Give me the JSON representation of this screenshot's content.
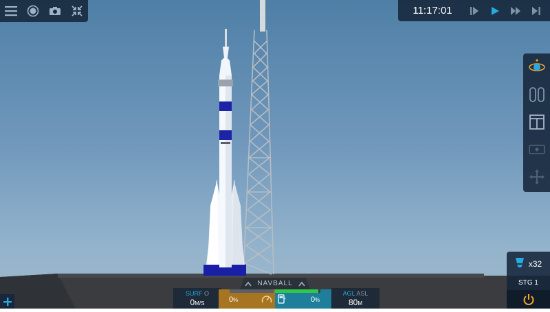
{
  "top_left": {
    "icons": [
      "menu-icon",
      "record-icon",
      "camera-icon",
      "collapse-icon"
    ]
  },
  "time_controls": {
    "clock": "11:17:01",
    "buttons": [
      "step-back-icon",
      "play-icon",
      "fast-forward-icon",
      "skip-icon"
    ]
  },
  "right_toolbar": {
    "items": [
      "orbit-view-icon",
      "part-list-icon",
      "layout-icon",
      "ticket-icon",
      "move-icon"
    ]
  },
  "stage": {
    "part_count": "x32",
    "stage_label": "STG 1",
    "activate_icon": "power-icon"
  },
  "hud": {
    "navball_label": "NAVBALL",
    "surf_label": "SURF",
    "surf_sub": "O",
    "surf_value": "0",
    "surf_unit": "M/S",
    "throttle_value": "0",
    "throttle_unit": "%",
    "throttle_level": 0,
    "fuel_value": "0",
    "fuel_unit": "%",
    "fuel_level": 0.95,
    "agl_label": "AGL",
    "agl_sub": "ASL",
    "agl_value": "80",
    "agl_unit": "M"
  },
  "colors": {
    "accent": "#28a9e0",
    "throttle": "#a77422",
    "fuel": "#1f7f9a",
    "power": "#f0a52a"
  }
}
